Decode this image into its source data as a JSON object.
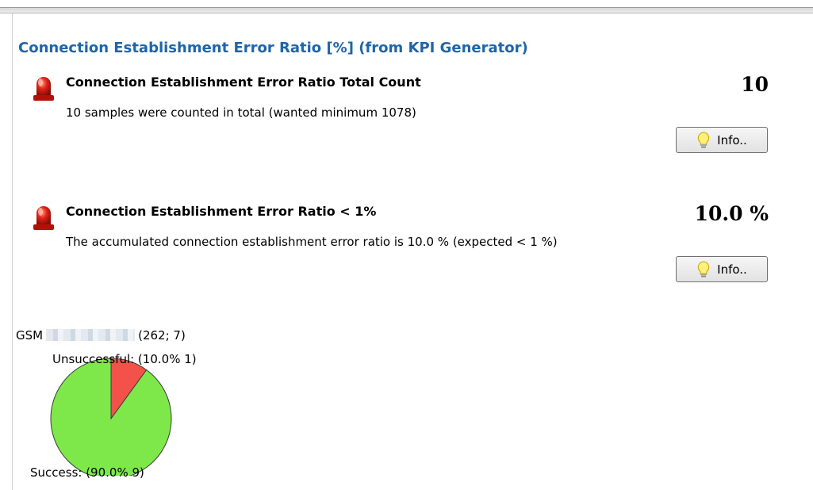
{
  "section": {
    "title": "Connection Establishment Error Ratio [%] (from KPI Generator)"
  },
  "kpis": [
    {
      "title": "Connection Establishment Error Ratio Total Count",
      "description": "10 samples were counted in total (wanted minimum 1078)",
      "value": "10",
      "info_label": "Info..",
      "status_icon": "red-alarm-icon"
    },
    {
      "title": "Connection Establishment Error Ratio < 1%",
      "description": "The accumulated connection establishment error ratio is 10.0 % (expected < 1 %)",
      "value": "10.0 %",
      "info_label": "Info..",
      "status_icon": "red-alarm-icon"
    }
  ],
  "pie": {
    "header_prefix": "GSM",
    "header_suffix": "(262; 7)"
  },
  "chart_data": {
    "type": "pie",
    "labels": [
      "Unsuccessful",
      "Success"
    ],
    "percentages": [
      10.0,
      90.0
    ],
    "counts": [
      1,
      9
    ],
    "label_texts": [
      "Unsuccessful: (10.0% 1)",
      "Success: (90.0% 9)"
    ],
    "colors": [
      "#f2524a",
      "#7ee84a"
    ]
  }
}
